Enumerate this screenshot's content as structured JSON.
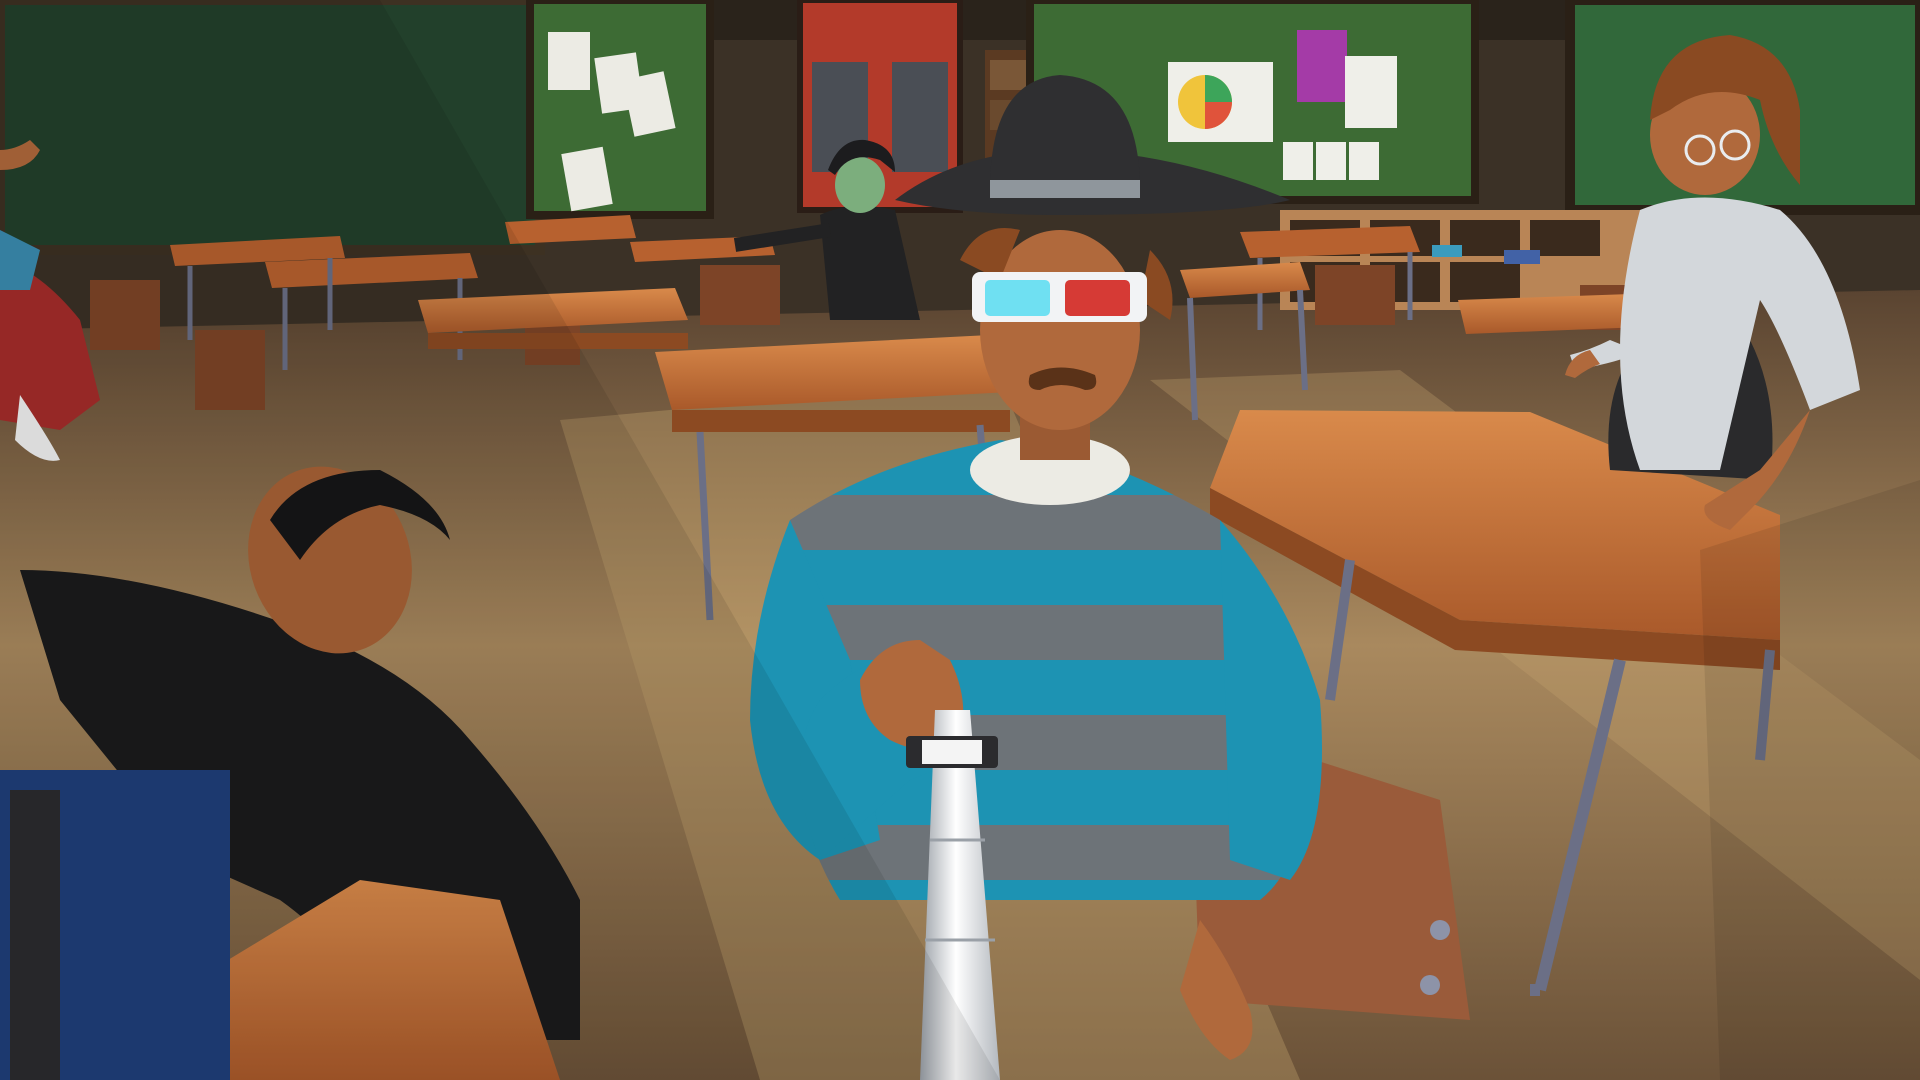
{
  "scene": {
    "setting": "classroom",
    "view": "selfie",
    "colors": {
      "wall": "#3b3126",
      "floor": "#b89566",
      "floor_shadow": "#4a3726",
      "chalkboard": "#22402b",
      "bulletin_board": "#3d6b34",
      "desk_top": "#c9743d",
      "desk_metal": "#6b6f86",
      "chair_seat": "#9a5b3a",
      "door": "#b33a2a",
      "sweater_teal": "#1d93b3",
      "sweater_grey": "#6d7378",
      "hat": "#2f2f31",
      "skin": "#b0693c",
      "glasses_cyan": "#6fe0f2",
      "glasses_red": "#d63a35",
      "teacher_shirt": "#d3d7db",
      "teacher_hair": "#8a4a22",
      "selfie_stick": "#e9ecef"
    },
    "icons": [
      "chalkboard-icon",
      "bulletin-board-icon",
      "door-icon",
      "bookshelf-icon",
      "student-desk-icon",
      "chair-icon",
      "selfie-stick-icon",
      "cowboy-hat-icon",
      "3d-glasses-icon",
      "avatar-icon"
    ]
  }
}
